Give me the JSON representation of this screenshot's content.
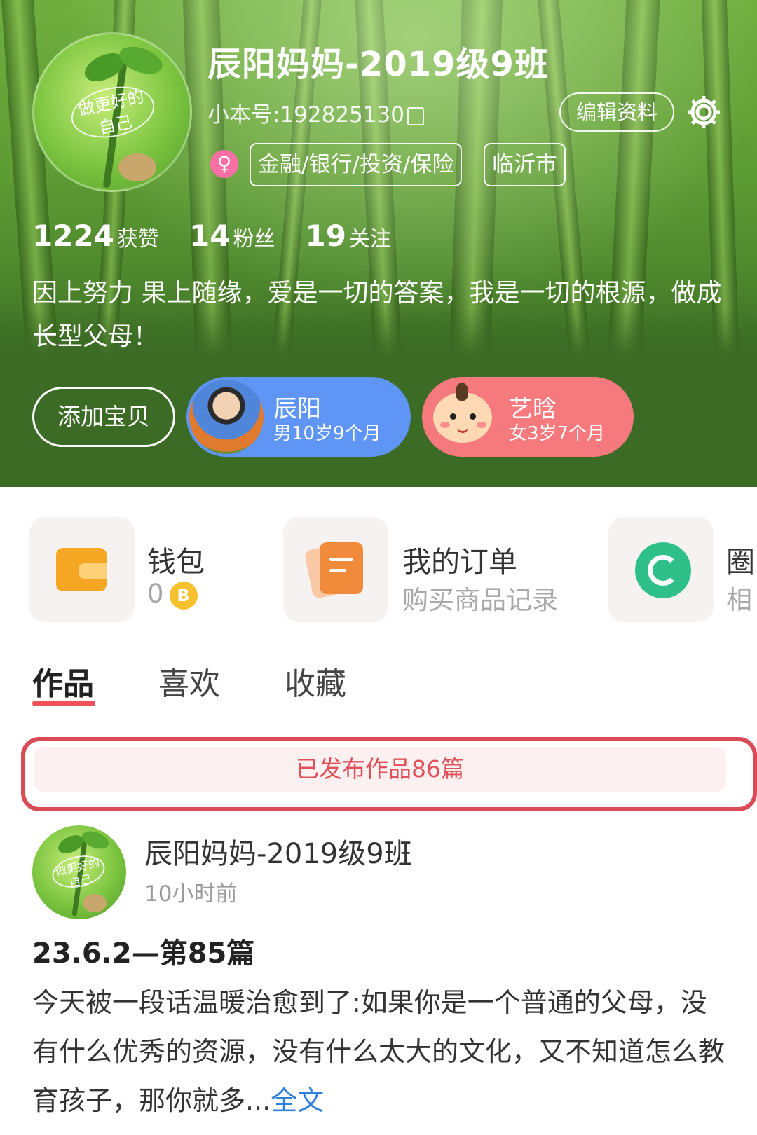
{
  "profile": {
    "username": "辰阳妈妈-2019级9班",
    "user_id": "小本号:192825130",
    "edit_label": "编辑资料",
    "gender_symbol": "♀",
    "tags": [
      "金融/银行/投资/保险",
      "临沂市"
    ],
    "stats": [
      {
        "value": "1224",
        "label": "获赞"
      },
      {
        "value": "14",
        "label": "粉丝"
      },
      {
        "value": "19",
        "label": "关注"
      }
    ],
    "bio": "因上努力 果上随缘，爱是一切的答案，我是一切的根源，做成长型父母！",
    "avatar_text": "做更好的自己",
    "add_baby_label": "添加宝贝",
    "babies": [
      {
        "name": "辰阳",
        "info": "男10岁9个月"
      },
      {
        "name": "艺晗",
        "info": "女3岁7个月"
      }
    ]
  },
  "services": [
    {
      "title": "钱包",
      "sub": "0",
      "coin_label": "B",
      "icon": "wallet-icon"
    },
    {
      "title": "我的订单",
      "sub": "购买商品记录",
      "icon": "order-icon"
    },
    {
      "title": "圈",
      "sub": "相",
      "icon": "circle-icon"
    }
  ],
  "tabs": [
    "作品",
    "喜欢",
    "收藏"
  ],
  "published_bar": "已发布作品86篇",
  "post": {
    "username": "辰阳妈妈-2019级9班",
    "time": "10小时前",
    "title": "23.6.2—第85篇",
    "body": "今天被一段话温暖治愈到了:如果你是一个普通的父母，没有什么优秀的资源，没有什么太大的文化，又不知道怎么教育孩子，那你就多...",
    "more_label": "全文"
  },
  "colors": {
    "accent": "#f1525a",
    "baby_boy": "#5f95f5",
    "baby_girl": "#f5797d",
    "link": "#2f7fdc"
  }
}
